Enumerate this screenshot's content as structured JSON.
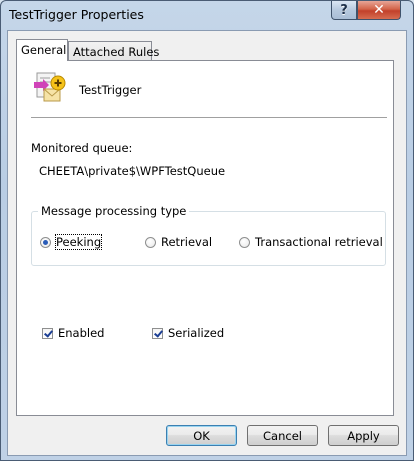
{
  "window": {
    "title": "TestTrigger Properties",
    "help_symbol": "?",
    "close_symbol": "✕"
  },
  "tabs": [
    {
      "label": "General",
      "selected": true
    },
    {
      "label": "Attached Rules",
      "selected": false
    }
  ],
  "general": {
    "trigger_name": "TestTrigger",
    "monitored_queue_label": "Monitored queue:",
    "monitored_queue_value": "CHEETA\\private$\\WPFTestQueue",
    "processing_group_title": "Message processing type",
    "processing_options": [
      {
        "label": "Peeking",
        "checked": true
      },
      {
        "label": "Retrieval",
        "checked": false
      },
      {
        "label": "Transactional retrieval",
        "checked": false
      }
    ],
    "enabled": {
      "label": "Enabled",
      "checked": true
    },
    "serialized": {
      "label": "Serialized",
      "checked": true
    }
  },
  "buttons": {
    "ok": "OK",
    "cancel": "Cancel",
    "apply": "Apply"
  },
  "colors": {
    "titlebar": "#b9cde4",
    "close_button": "#c2402a",
    "radio_dot": "#2a5cb8",
    "default_button_border": "#3c7fb1"
  }
}
